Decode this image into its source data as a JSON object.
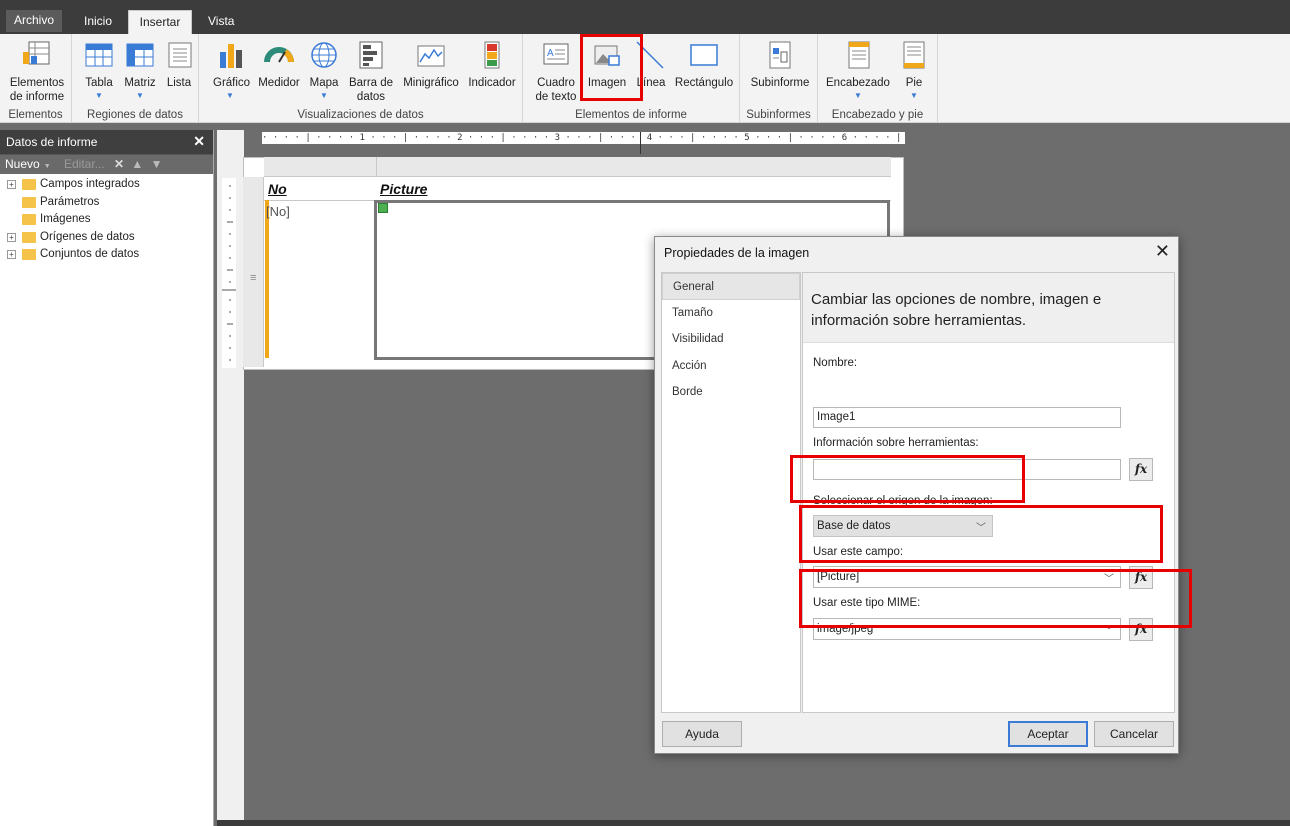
{
  "tabs": [
    {
      "label": "Archivo"
    },
    {
      "label": "Inicio"
    },
    {
      "label": "Insertar"
    },
    {
      "label": "Vista"
    }
  ],
  "ribbon": {
    "groups": {
      "elementos": "Elementos",
      "regiones": "Regiones de datos",
      "visualizaciones": "Visualizaciones de datos",
      "elementos_informe": "Elementos de informe",
      "subinformes": "Subinformes",
      "encabezado_pie": "Encabezado y pie"
    },
    "buttons": {
      "elementos_informe_1": "Elementos",
      "elementos_informe_2": "de informe",
      "tabla": "Tabla",
      "matriz": "Matriz",
      "lista": "Lista",
      "grafico": "Gráfico",
      "medidor": "Medidor",
      "mapa": "Mapa",
      "barra_datos_1": "Barra de",
      "barra_datos_2": "datos",
      "minigrafico": "Minigráfico",
      "indicador": "Indicador",
      "cuadro_texto_1": "Cuadro",
      "cuadro_texto_2": "de texto",
      "imagen": "Imagen",
      "linea": "Línea",
      "rectangulo": "Rectángulo",
      "subinforme": "Subinforme",
      "encabezado": "Encabezado",
      "pie": "Pie"
    }
  },
  "left_panel": {
    "title": "Datos de informe",
    "toolbar": {
      "nuevo": "Nuevo",
      "editar": "Editar..."
    },
    "tree": [
      {
        "label": "Campos integrados",
        "expandable": true
      },
      {
        "label": "Parámetros",
        "expandable": false
      },
      {
        "label": "Imágenes",
        "expandable": false
      },
      {
        "label": "Orígenes de datos",
        "expandable": true
      },
      {
        "label": "Conjuntos de datos",
        "expandable": true
      }
    ]
  },
  "ruler": {
    "marks": "· · · · | · · · · 1 · · · | · · · · 2 · · · | · · · · 3 · · · | · · ·  4 · · · | · · · · 5 · · · | · · · · 6 · · · · |"
  },
  "table": {
    "headers": [
      "No",
      "Picture"
    ],
    "row": [
      "[No]"
    ]
  },
  "dialog": {
    "title": "Propiedades de la imagen",
    "nav": [
      "General",
      "Tamaño",
      "Visibilidad",
      "Acción",
      "Borde"
    ],
    "heading_line1": "Cambiar las opciones de nombre, imagen e",
    "heading_line2": "información sobre herramientas.",
    "nombre_label": "Nombre:",
    "nombre_value": "Image1",
    "tooltip_label": "Información sobre herramientas:",
    "tooltip_value": "",
    "origen_label": "Seleccionar el origen de la imagen:",
    "origen_value": "Base de datos",
    "campo_label": "Usar este campo:",
    "campo_value": "[Picture]",
    "mime_label": "Usar este tipo MIME:",
    "mime_value": "image/jpeg",
    "fx_label": "fx",
    "ayuda": "Ayuda",
    "aceptar": "Aceptar",
    "cancelar": "Cancelar"
  },
  "colors": {
    "highlight": "#e60000",
    "accent": "#3a7bd5",
    "folder": "#f5c24a",
    "row_marker": "#f0a81a"
  }
}
